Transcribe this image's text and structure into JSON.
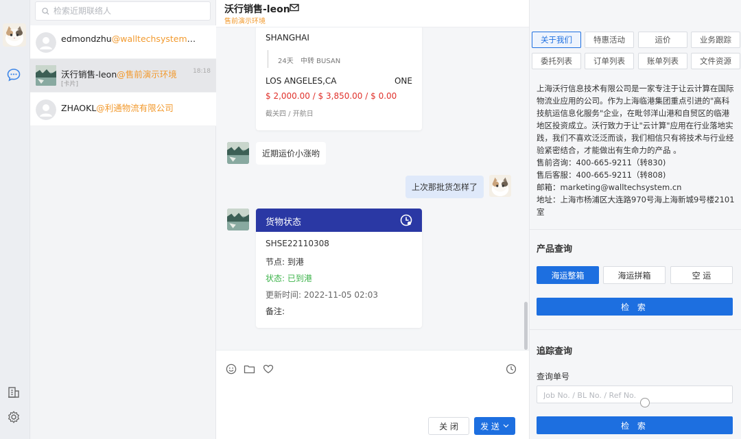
{
  "colors": {
    "accent": "#1d6fe0",
    "orange": "#f29a2e",
    "red": "#e0302a",
    "green": "#3cb34a",
    "cardHeader": "#2a38a4"
  },
  "search": {
    "placeholder": "检索近期联络人"
  },
  "contacts": [
    {
      "name": "edmondzhu",
      "org": "@walltechsystem.com",
      "time": "",
      "sub": ""
    },
    {
      "name": "沃行销售-leon",
      "org": "@售前演示环境",
      "time": "18:18",
      "sub": "[卡片]"
    },
    {
      "name": "ZHAOKL",
      "org": "@利通物流有限公司",
      "time": "",
      "sub": ""
    }
  ],
  "chat": {
    "title": "沃行销售-leon",
    "subtitle": "售前演示环境",
    "rate_card": {
      "origin": "SHANGHAI",
      "days": "24天",
      "transit": "中转 BUSAN",
      "destination": "LOS ANGELES,CA",
      "carrier": "ONE",
      "price": "$ 2,000.00 / $ 3,850.00 / $ 0.00",
      "schedule": "截关四 / 开航日"
    },
    "msg_in": "近期运价小涨哟",
    "msg_out": "上次那批货怎样了",
    "status_card": {
      "header": "货物状态",
      "number": "SHSE22110308",
      "node": "节点: 到港",
      "state": "状态: 已到港",
      "updated": "更新时间: 2022-11-05 02:03",
      "remark": "备注:"
    },
    "close_label": "关 闭",
    "send_label": "发 送"
  },
  "side": {
    "tabs": [
      "关于我们",
      "特惠活动",
      "运价",
      "业务跟踪",
      "委托列表",
      "订单列表",
      "账单列表",
      "文件资源"
    ],
    "about_lines": [
      "上海沃行信息技术有限公司是一家专注于让云计算在国际物流业应用的公司。作为上海临港集团重点引进的\"高科技航运信息化服务\"企业，在毗邻洋山港和自贸区的临港地区投资成立。沃行致力于让\"云计算\"应用在行业落地实践，我们不喜欢泛泛而谈，我们相信只有将技术与行业经验紧密结合，才能做出有生命力的产品 。",
      "售前咨询：400-665-9211（转830)",
      "售后客服：400-665-9211（转808)",
      "邮箱：marketing@walltechsystem.cn",
      "地址：上海市杨浦区大连路970号海上海新城9号楼2101室"
    ],
    "product_title": "产品查询",
    "product_tabs": [
      "海运整箱",
      "海运拼箱",
      "空 运"
    ],
    "search_btn": "检 索",
    "track_title": "追踪查询",
    "track_label": "查询单号",
    "track_placeholder": "Job No. / BL No. / Ref No.",
    "track_btn": "检 索"
  }
}
